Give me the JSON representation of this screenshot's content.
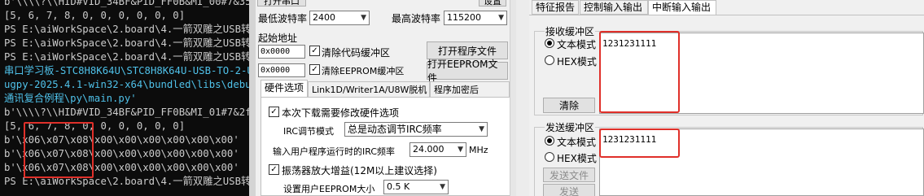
{
  "terminal": {
    "lines": [
      "b'\\\\\\\\?\\\\HID#VID_34BF&PID_FF0B&MI_00#7&3524",
      "[5, 6, 7, 8, 0, 0, 0, 0, 0, 0]",
      "PS E:\\aiWorkSpace\\2.board\\4.一箭双雕之USB转",
      "PS E:\\aiWorkSpace\\2.board\\4.一箭双雕之USB转",
      "PS E:\\aiWorkSpace\\2.board\\4.一箭双雕之USB转",
      "串口学习板-STC8H8K64U\\STC8H8K64U-USB-TO-2-U",
      "ugpy-2025.4.1-win32-x64\\bundled\\libs\\debugp",
      "通讯复合例程\\py\\main.py'",
      "b'\\\\\\\\?\\\\HID#VID_34BF&PID_FF0B&MI_01#7&2fce",
      "[5, 6, 7, 8, 0, 0, 0, 0, 0, 0]",
      "b'\\x06\\x07\\x08\\x00\\x00\\x00\\x00\\x00\\x00'",
      "b'\\x06\\x07\\x08\\x00\\x00\\x00\\x00\\x00\\x00'",
      "b'\\x06\\x07\\x08\\x00\\x00\\x00\\x00\\x00\\x00'",
      "PS E:\\aiWorkSpace\\2.board\\4.一箭双雕之USB转"
    ]
  },
  "stc": {
    "open_serial_label": "打开串口",
    "settings_label": "设置",
    "min_baud_label": "最低波特率",
    "min_baud_value": "2400",
    "max_baud_label": "最高波特率",
    "max_baud_value": "115200",
    "start_addr_label": "起始地址",
    "addr1": "0x0000",
    "clear_code_label": "清除代码缓冲区",
    "open_program_label": "打开程序文件",
    "addr2": "0x0000",
    "clear_eeprom_label": "清除EEPROM缓冲区",
    "open_eeprom_label": "打开EEPROM文件",
    "tabs": [
      "硬件选项",
      "Link1D/Writer1A/U8W脱机",
      "程序加密后"
    ],
    "hw": {
      "modify_hw_label": "本次下载需要修改硬件选项",
      "irc_mode_label": "IRC调节模式",
      "irc_mode_value": "总是动态调节IRC频率",
      "irc_freq_label": "输入用户程序运行时的IRC频率",
      "irc_freq_value": "24.000",
      "irc_freq_unit": "MHz",
      "osc_gain_label": "振荡器放大增益(12M以上建议选择)",
      "eeprom_size_label": "设置用户EEPROM大小",
      "eeprom_size_value": "0.5 K"
    }
  },
  "serial": {
    "tabs": [
      "特征报告",
      "控制输入输出",
      "中断输入输出"
    ],
    "recv": {
      "title": "接收缓冲区",
      "text_mode": "文本模式",
      "hex_mode": "HEX模式",
      "clear": "清除",
      "content": "1231231111"
    },
    "send": {
      "title": "发送缓冲区",
      "text_mode": "文本模式",
      "hex_mode": "HEX模式",
      "send_file": "发送文件",
      "send": "发送",
      "content": "1231231111"
    }
  },
  "colors": {
    "terminal_bg": "#0c0c0c",
    "terminal_fg": "#cccccc",
    "highlight": "#e0302a"
  }
}
